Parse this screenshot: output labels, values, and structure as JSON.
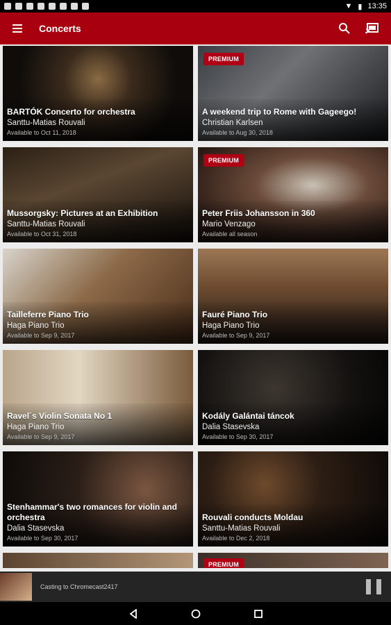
{
  "status": {
    "time": "13:35"
  },
  "app": {
    "title": "Concerts"
  },
  "cards": [
    {
      "title": "BARTÓK Concerto for orchestra",
      "subtitle": "Santtu-Matias Rouvali",
      "availability": "Available to Oct 11, 2018",
      "premium": ""
    },
    {
      "title": "A weekend trip to Rome with Gageego!",
      "subtitle": "Christian Karlsen",
      "availability": "Available to Aug 30, 2018",
      "premium": "PREMIUM"
    },
    {
      "title": "Mussorgsky: Pictures at an Exhibition",
      "subtitle": "Santtu-Matias Rouvali",
      "availability": "Available to Oct 31, 2018",
      "premium": ""
    },
    {
      "title": "Peter Friis Johansson in 360",
      "subtitle": "Mario Venzago",
      "availability": "Available all season",
      "premium": "PREMIUM"
    },
    {
      "title": "Tailleferre Piano Trio",
      "subtitle": "Haga Piano Trio",
      "availability": "Available to Sep 9, 2017",
      "premium": ""
    },
    {
      "title": "Fauré Piano Trio",
      "subtitle": "Haga Piano Trio",
      "availability": "Available to Sep 9, 2017",
      "premium": ""
    },
    {
      "title": "Ravel´s Violin Sonata No 1",
      "subtitle": "Haga Piano Trio",
      "availability": "Available to Sep 9, 2017",
      "premium": ""
    },
    {
      "title": "Kodály Galántai táncok",
      "subtitle": "Dalia Stasevska",
      "availability": "Available to Sep 30, 2017",
      "premium": ""
    },
    {
      "title": "Stenhammar's two romances for violin and orchestra",
      "subtitle": "Dalia Stasevska",
      "availability": "Available to Sep 30, 2017",
      "premium": ""
    },
    {
      "title": "Rouvali conducts Moldau",
      "subtitle": "Santtu-Matias Rouvali",
      "availability": "Available to Dec 2, 2018",
      "premium": ""
    }
  ],
  "partial_cards": [
    {
      "premium": ""
    },
    {
      "premium": "PREMIUM"
    }
  ],
  "cast": {
    "text": "Casting to Chromecast2417"
  },
  "colors": {
    "accent": "#a8000f",
    "premium": "#b00013"
  }
}
